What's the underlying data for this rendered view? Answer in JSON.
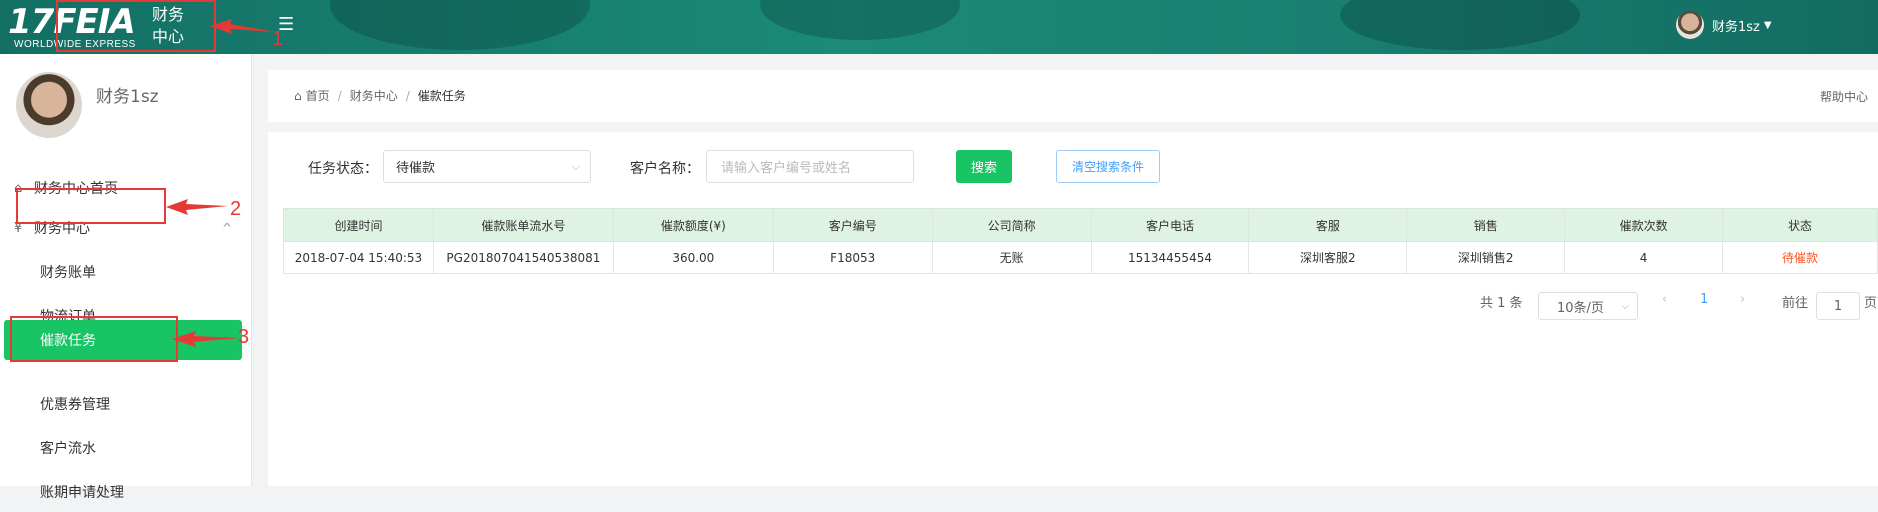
{
  "header": {
    "logo_text": "17FEIA",
    "logo_sub": "WORLDWIDE EXPRESS",
    "app_title": "财务中心",
    "menu_icon": "hamburger-icon",
    "user_name": "财务1sz"
  },
  "annotations": {
    "label1": "1",
    "label2": "2",
    "label3": "3",
    "color": "#e53935"
  },
  "sidebar": {
    "user_name": "财务1sz",
    "items": [
      {
        "label": "财务中心首页",
        "icon": "home-icon"
      },
      {
        "label": "财务中心",
        "icon": "yen-icon"
      },
      {
        "label": "财务账单"
      },
      {
        "label": "物流订单"
      },
      {
        "label": "催款任务"
      },
      {
        "label": "优惠券管理"
      },
      {
        "label": "客户流水"
      },
      {
        "label": "账期申请处理"
      }
    ]
  },
  "breadcrumb": {
    "home": "首页",
    "level2": "财务中心",
    "current": "催款任务"
  },
  "help_link": "帮助中心",
  "filters": {
    "status_label": "任务状态：",
    "status_value": "待催款",
    "customer_label": "客户名称：",
    "customer_placeholder": "请输入客户编号或姓名",
    "search_button": "搜索",
    "clear_button": "清空搜索条件"
  },
  "table": {
    "headers": [
      "创建时间",
      "催款账单流水号",
      "催款额度(¥)",
      "客户编号",
      "公司简称",
      "客户电话",
      "客服",
      "销售",
      "催款次数",
      "状态"
    ],
    "rows": [
      [
        "2018-07-04 15:40:53",
        "PG201807041540538081",
        "360.00",
        "F18053",
        "无账",
        "15134455454",
        "深圳客服2",
        "深圳销售2",
        "4",
        "待催款"
      ]
    ]
  },
  "pagination": {
    "total": "共 1 条",
    "page_size": "10条/页",
    "current_page": "1",
    "goto_label": "前往",
    "goto_value": "1",
    "page_suffix": "页"
  },
  "colors": {
    "accent": "#19c465",
    "header": "#1b8a78",
    "status": "#ff5722"
  }
}
